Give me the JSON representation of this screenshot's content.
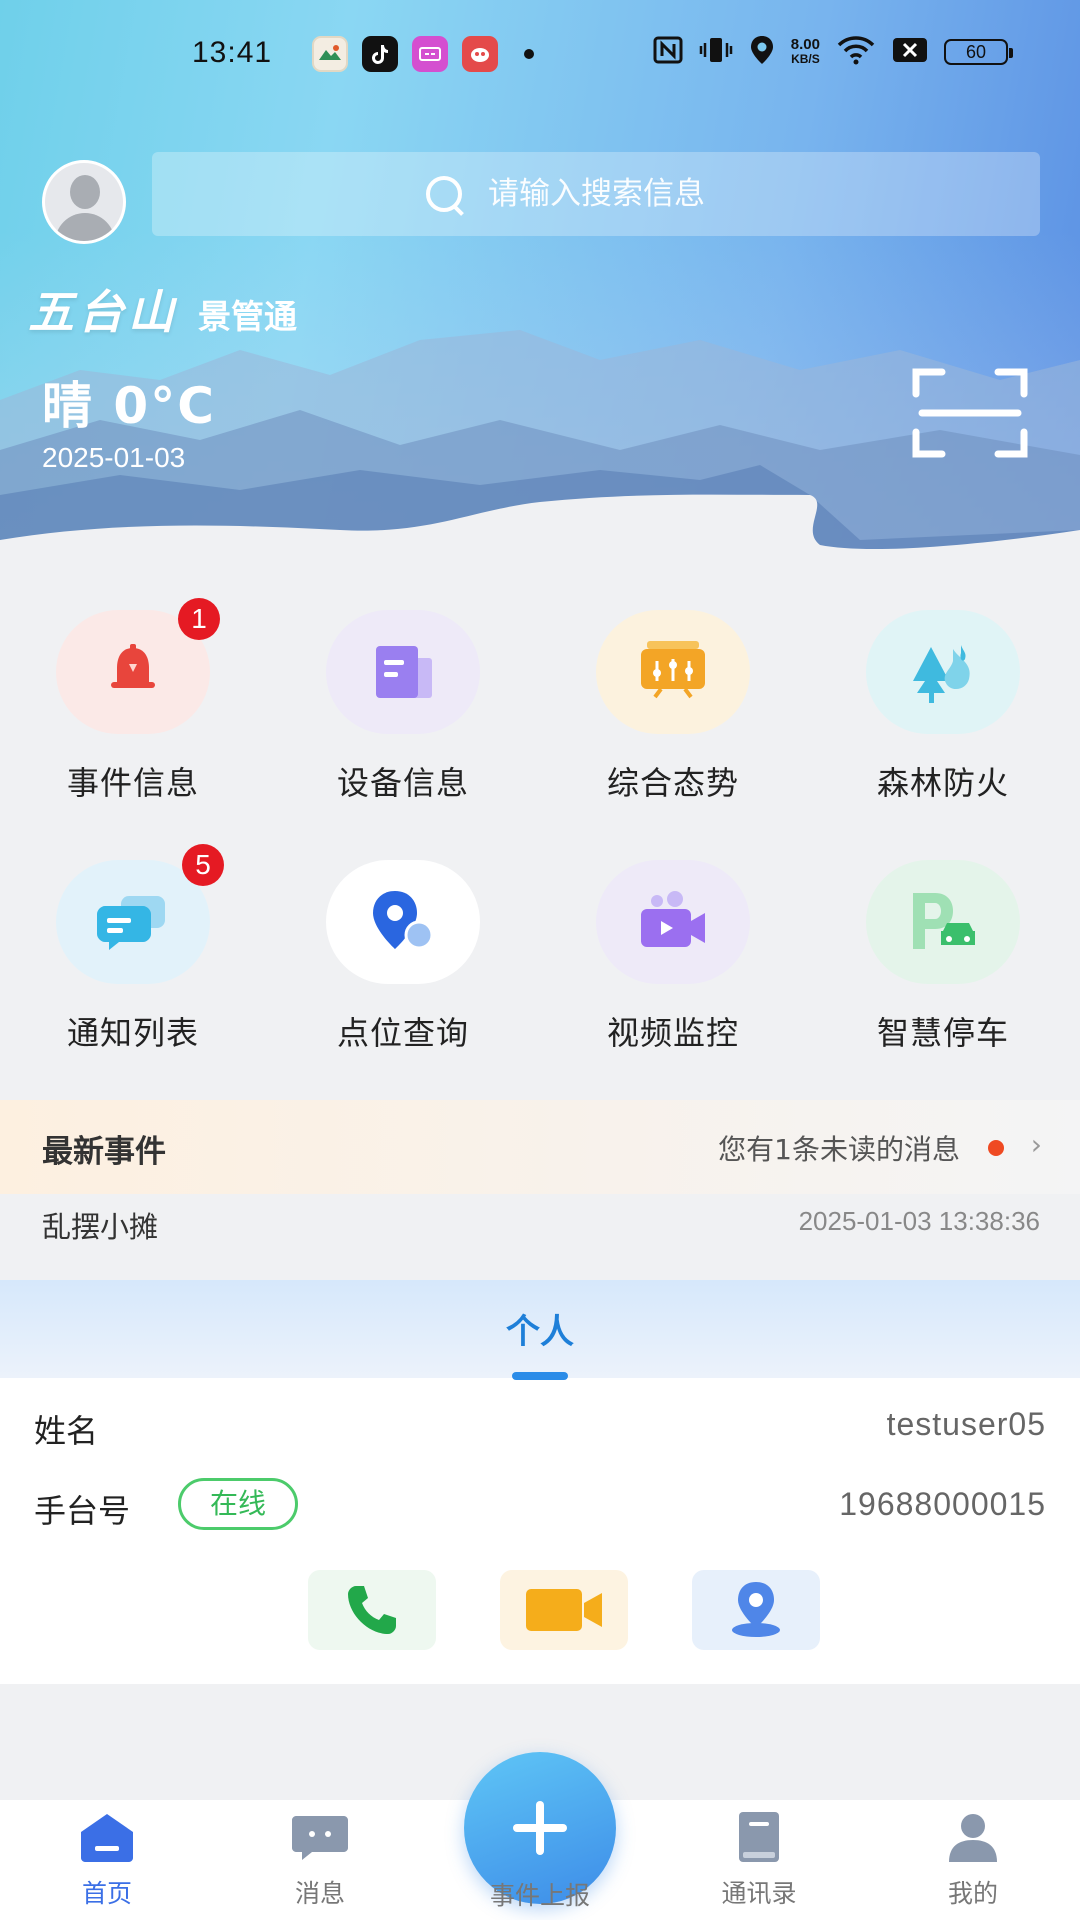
{
  "status_bar": {
    "time": "13:41",
    "net_speed_value": "8.00",
    "net_speed_unit": "KB/S",
    "battery": "60"
  },
  "header": {
    "search_placeholder": "请输入搜索信息",
    "brand_logo_text": "五台山",
    "app_name": "景管通",
    "weather": "晴 0°C",
    "date": "2025-01-03"
  },
  "grid": {
    "items": [
      {
        "label": "事件信息",
        "icon": "bell-icon",
        "badge": "1",
        "color": "#e8453c"
      },
      {
        "label": "设备信息",
        "icon": "document-icon",
        "badge": "",
        "color": "#9a7ff0"
      },
      {
        "label": "综合态势",
        "icon": "dashboard-icon",
        "badge": "",
        "color": "#f3a526"
      },
      {
        "label": "森林防火",
        "icon": "forest-fire-icon",
        "badge": "",
        "color": "#3fbadf"
      },
      {
        "label": "通知列表",
        "icon": "chat-bubble-icon",
        "badge": "5",
        "color": "#34b6e5"
      },
      {
        "label": "点位查询",
        "icon": "location-search-icon",
        "badge": "",
        "color": "#2a66e0"
      },
      {
        "label": "视频监控",
        "icon": "video-camera-icon",
        "badge": "",
        "color": "#9b6ff0"
      },
      {
        "label": "智慧停车",
        "icon": "parking-icon",
        "badge": "",
        "color": "#3bbf6c"
      }
    ]
  },
  "events": {
    "title": "最新事件",
    "unread_text": "您有1条未读的消息",
    "item_name": "乱摆小摊",
    "item_time": "2025-01-03 13:38:36"
  },
  "personal": {
    "tab_label": "个人",
    "name_key": "姓名",
    "name_value": "testuser05",
    "radio_key": "手台号",
    "status": "在线",
    "radio_value": "19688000015"
  },
  "bottom_nav": {
    "home": "首页",
    "messages": "消息",
    "report": "事件上报",
    "contacts": "通讯录",
    "mine": "我的"
  },
  "colors": {
    "accent": "#3b6fe6",
    "badge_red": "#e51a23",
    "online_green": "#34b957"
  }
}
